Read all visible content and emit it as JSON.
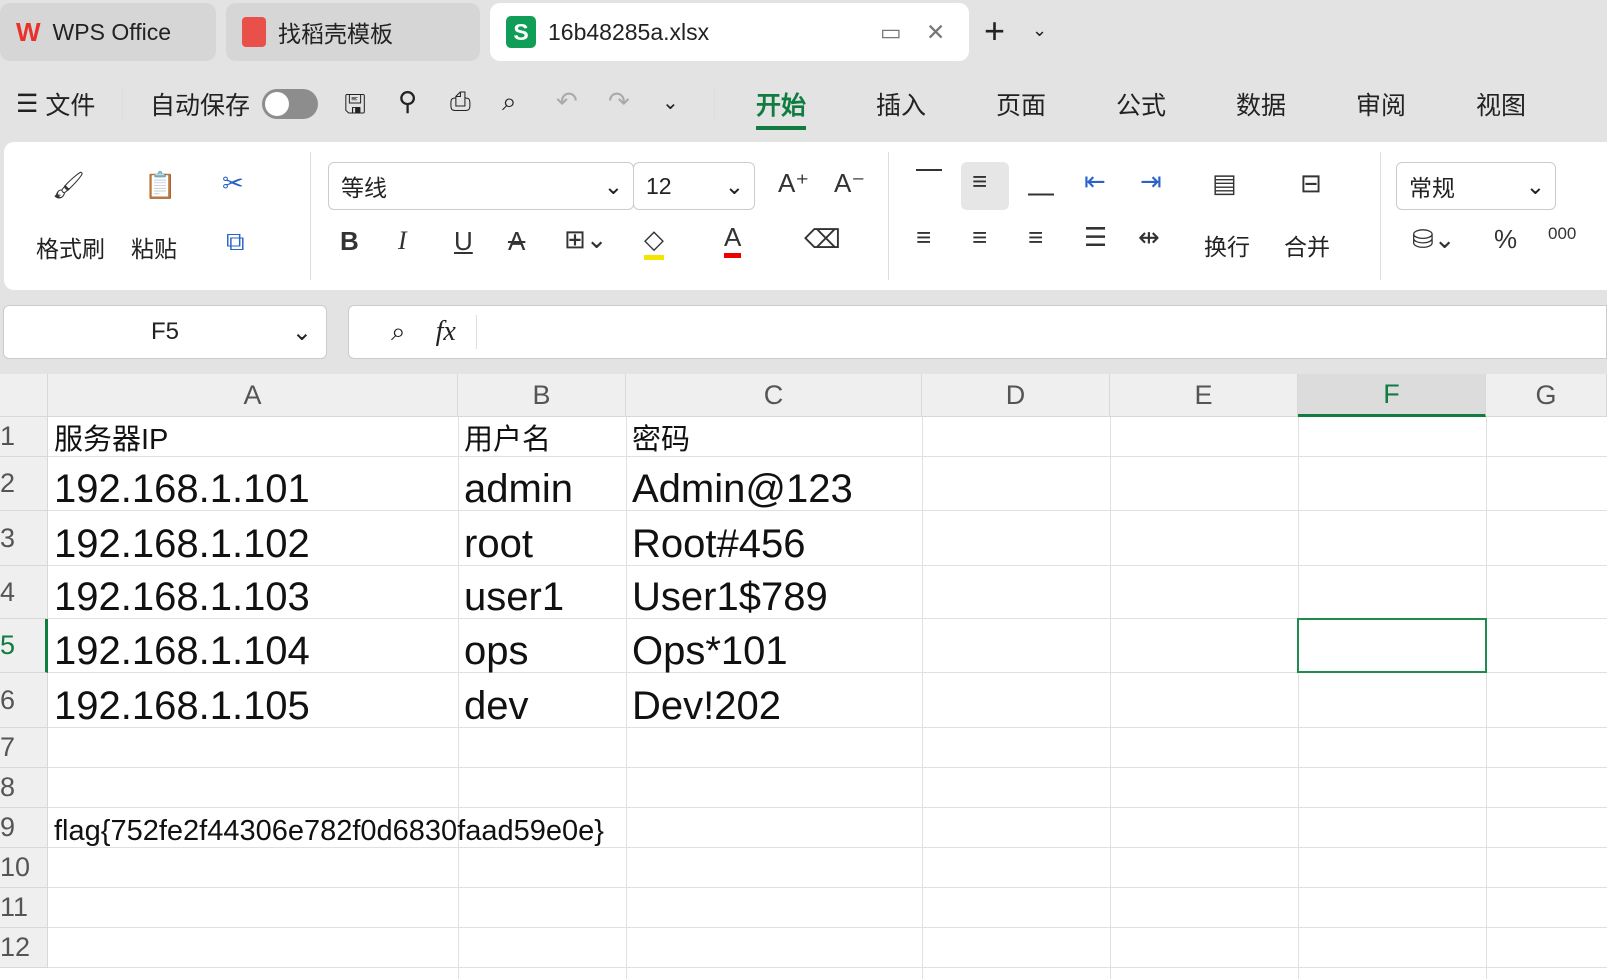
{
  "tabs": [
    {
      "label": "WPS Office",
      "icon": "wps-logo-icon"
    },
    {
      "label": "找稻壳模板",
      "icon": "docer-icon"
    },
    {
      "label": "16b48285a.xlsx",
      "icon": "spreadsheet-s-icon"
    }
  ],
  "menu": {
    "file": "文件",
    "autosave": "自动保存",
    "autosave_on": false,
    "tabs": [
      "开始",
      "插入",
      "页面",
      "公式",
      "数据",
      "审阅",
      "视图"
    ],
    "active_tab": "开始"
  },
  "ribbon": {
    "format_painter": "格式刷",
    "paste": "粘贴",
    "font": "等线",
    "size": "12",
    "wrap": "换行",
    "merge": "合并",
    "number_format": "常规",
    "bold": "B",
    "italic": "I",
    "underline": "U",
    "percent": "%",
    "thousands": "000"
  },
  "formula_bar": {
    "cell_ref": "F5",
    "fx": "fx",
    "value": ""
  },
  "sheet": {
    "columns": [
      "A",
      "B",
      "C",
      "D",
      "E",
      "F",
      "G"
    ],
    "selected_column": "F",
    "rows": [
      "1",
      "2",
      "3",
      "4",
      "5",
      "6",
      "7",
      "8",
      "9",
      "10",
      "11",
      "12"
    ],
    "selected_row": "5",
    "cells": [
      [
        "服务器IP",
        "用户名",
        "密码"
      ],
      [
        "192.168.1.101",
        "admin",
        "Admin@123"
      ],
      [
        "192.168.1.102",
        "root",
        "Root#456"
      ],
      [
        "192.168.1.103",
        "user1",
        "User1$789"
      ],
      [
        "192.168.1.104",
        "ops",
        "Ops*101"
      ],
      [
        "192.168.1.105",
        "dev",
        "Dev!202"
      ]
    ],
    "a9": "flag{752fe2f44306e782f0d6830faad59e0e}"
  },
  "colors": {
    "accent": "#107c41",
    "selection": "#1e8c4e"
  }
}
